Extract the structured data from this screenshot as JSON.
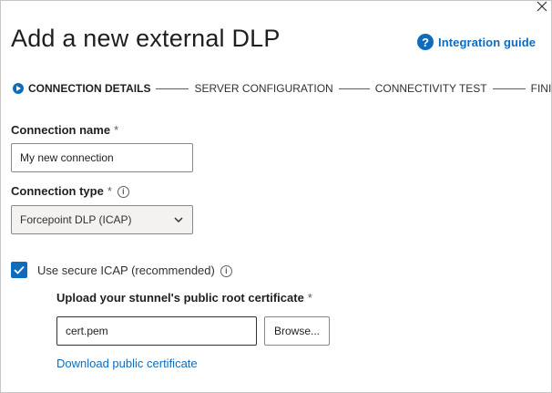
{
  "header": {
    "title": "Add a new external DLP",
    "guide_icon": "?",
    "guide_label": "Integration guide",
    "close_icon": "close-icon"
  },
  "steps": [
    {
      "label": "CONNECTION DETAILS",
      "active": true
    },
    {
      "label": "SERVER CONFIGURATION",
      "active": false
    },
    {
      "label": "CONNECTIVITY TEST",
      "active": false
    },
    {
      "label": "FINISH",
      "active": false
    }
  ],
  "form": {
    "required_marker": "*",
    "info_glyph": "i",
    "connection_name": {
      "label": "Connection name",
      "value": "My new connection"
    },
    "connection_type": {
      "label": "Connection type",
      "value": "Forcepoint DLP (ICAP)"
    },
    "secure_icap": {
      "label": "Use secure ICAP (recommended)",
      "checked": true
    },
    "certificate": {
      "label": "Upload your stunnel's public root certificate",
      "value": "cert.pem",
      "browse_label": "Browse..."
    },
    "download_link": "Download public certificate"
  },
  "colors": {
    "accent": "#0f6cbd",
    "text": "#201f1e",
    "border": "#8a8886"
  }
}
